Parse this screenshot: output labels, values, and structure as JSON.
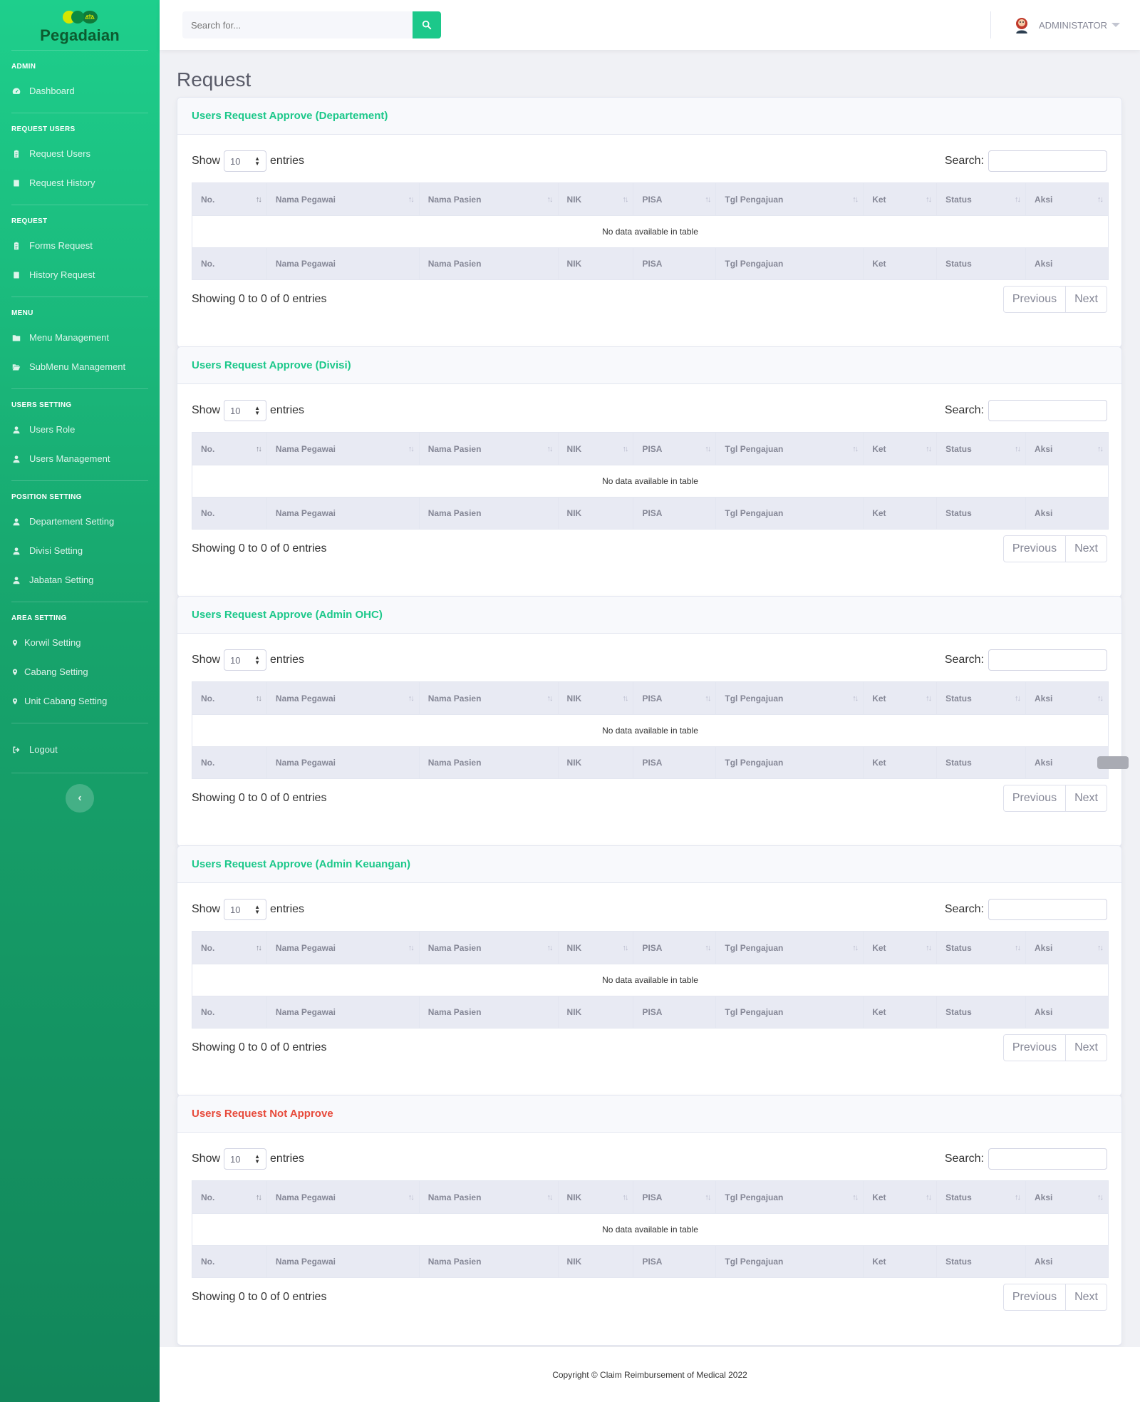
{
  "brand": {
    "name": "Pegadaian"
  },
  "sidebar": {
    "sections": [
      {
        "heading": "ADMIN",
        "items": [
          {
            "label": "Dashboard",
            "icon": "dashboard-icon"
          }
        ]
      },
      {
        "heading": "REQUEST USERS",
        "items": [
          {
            "label": "Request Users",
            "icon": "clipboard-icon"
          },
          {
            "label": "Request History",
            "icon": "book-icon"
          }
        ]
      },
      {
        "heading": "REQUEST",
        "items": [
          {
            "label": "Forms Request",
            "icon": "clipboard-icon"
          },
          {
            "label": "History Request",
            "icon": "book-icon"
          }
        ]
      },
      {
        "heading": "MENU",
        "items": [
          {
            "label": "Menu Management",
            "icon": "folder-icon"
          },
          {
            "label": "SubMenu Management",
            "icon": "folder-open-icon"
          }
        ]
      },
      {
        "heading": "USERS SETTING",
        "items": [
          {
            "label": "Users Role",
            "icon": "user-icon"
          },
          {
            "label": "Users Management",
            "icon": "user-icon"
          }
        ]
      },
      {
        "heading": "POSITION SETTING",
        "items": [
          {
            "label": "Departement Setting",
            "icon": "user-icon"
          },
          {
            "label": "Divisi Setting",
            "icon": "user-icon"
          },
          {
            "label": "Jabatan Setting",
            "icon": "user-icon"
          }
        ]
      },
      {
        "heading": "AREA SETTING",
        "items": [
          {
            "label": "Korwil Setting",
            "icon": "map-pin-icon"
          },
          {
            "label": "Cabang Setting",
            "icon": "map-pin-icon"
          },
          {
            "label": "Unit Cabang Setting",
            "icon": "map-pin-icon"
          }
        ]
      }
    ],
    "logout": "Logout"
  },
  "topbar": {
    "search_placeholder": "Search for...",
    "user_name": "ADMINISTATOR"
  },
  "page": {
    "title": "Request"
  },
  "table_common": {
    "show_label": "Show",
    "entries_label": "entries",
    "page_size": "10",
    "search_label": "Search:",
    "columns": [
      "No.",
      "Nama Pegawai",
      "Nama Pasien",
      "NIK",
      "PISA",
      "Tgl Pengajuan",
      "Ket",
      "Status",
      "Aksi"
    ],
    "empty_text": "No data available in table",
    "info_text": "Showing 0 to 0 of 0 entries",
    "prev_label": "Previous",
    "next_label": "Next"
  },
  "cards": [
    {
      "title": "Users Request Approve (Departement)",
      "variant": "success"
    },
    {
      "title": "Users Request Approve (Divisi)",
      "variant": "success"
    },
    {
      "title": "Users Request Approve (Admin OHC)",
      "variant": "success"
    },
    {
      "title": "Users Request Approve (Admin Keuangan)",
      "variant": "success"
    },
    {
      "title": "Users Request Not Approve",
      "variant": "danger"
    }
  ],
  "colors": {
    "primary": "#1cc88a",
    "danger": "#e74a3b",
    "sidebar_top": "#1ecf8c",
    "sidebar_bottom": "#12865a"
  },
  "footer": {
    "text": "Copyright © Claim Reimbursement of Medical 2022"
  }
}
